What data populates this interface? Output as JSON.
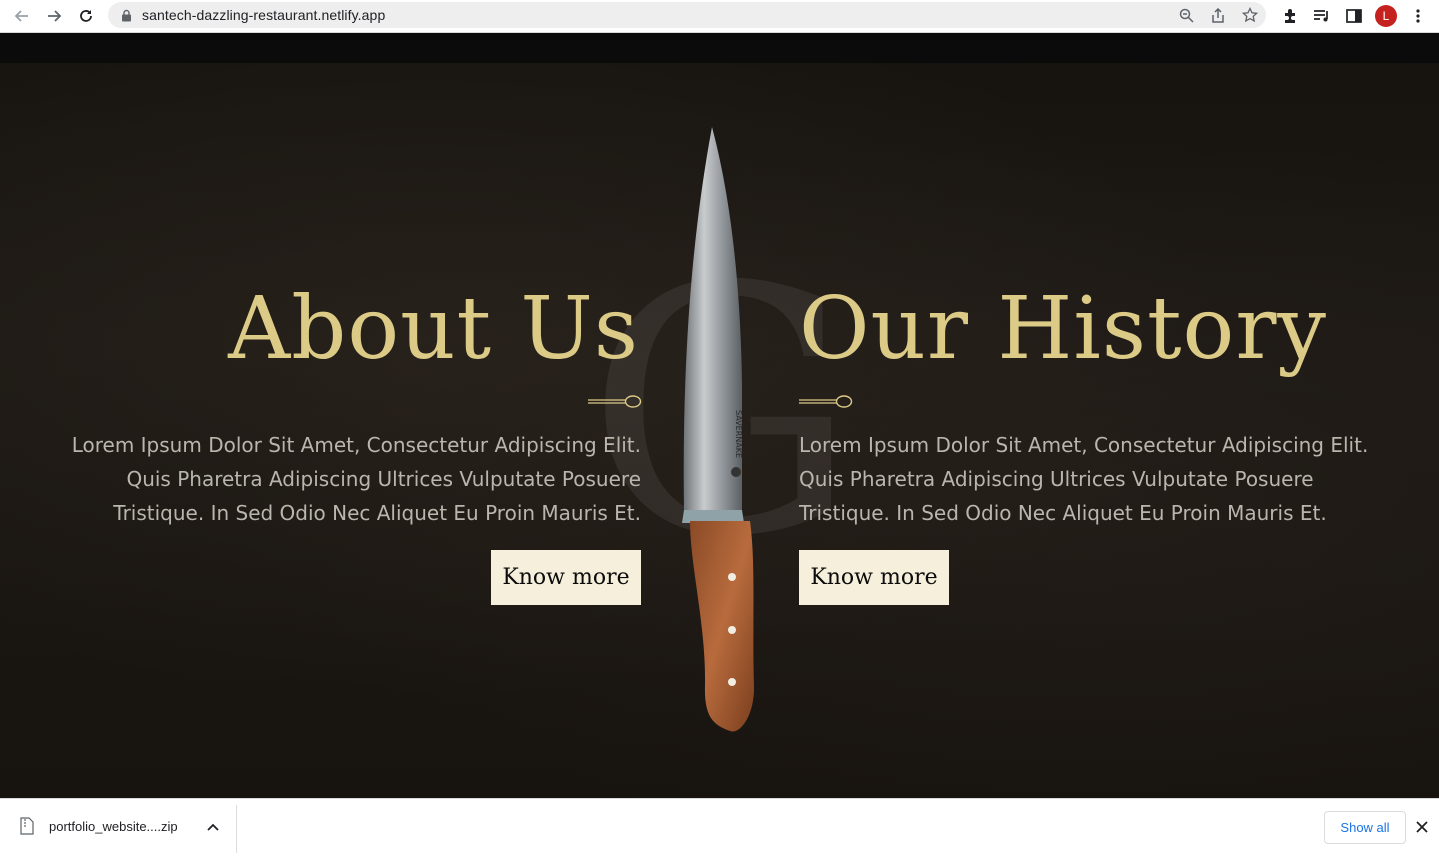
{
  "browser": {
    "url": "santech-dazzling-restaurant.netlify.app",
    "avatar_letter": "L"
  },
  "hero": {
    "background_letter": "G",
    "knife_brand": "SAVERNAKE",
    "about": {
      "title": "About Us",
      "lines": [
        "Lorem Ipsum Dolor Sit Amet, Consectetur Adipiscing Elit.",
        "Quis Pharetra Adipiscing Ultrices Vulputate Posuere",
        "Tristique. In Sed Odio Nec Aliquet Eu Proin Mauris Et."
      ],
      "button": "Know more"
    },
    "history": {
      "title": "Our History",
      "lines": [
        "Lorem Ipsum Dolor Sit Amet, Consectetur Adipiscing Elit.",
        "Quis Pharetra Adipiscing Ultrices Vulputate Posuere",
        "Tristique. In Sed Odio Nec Aliquet Eu Proin Mauris Et."
      ],
      "button": "Know more"
    }
  },
  "download_bar": {
    "file_name": "portfolio_website....zip",
    "show_all": "Show all"
  },
  "colors": {
    "gold": "#dcca87",
    "button_bg": "#f5efdb",
    "text_grey": "#b9b6ad"
  }
}
